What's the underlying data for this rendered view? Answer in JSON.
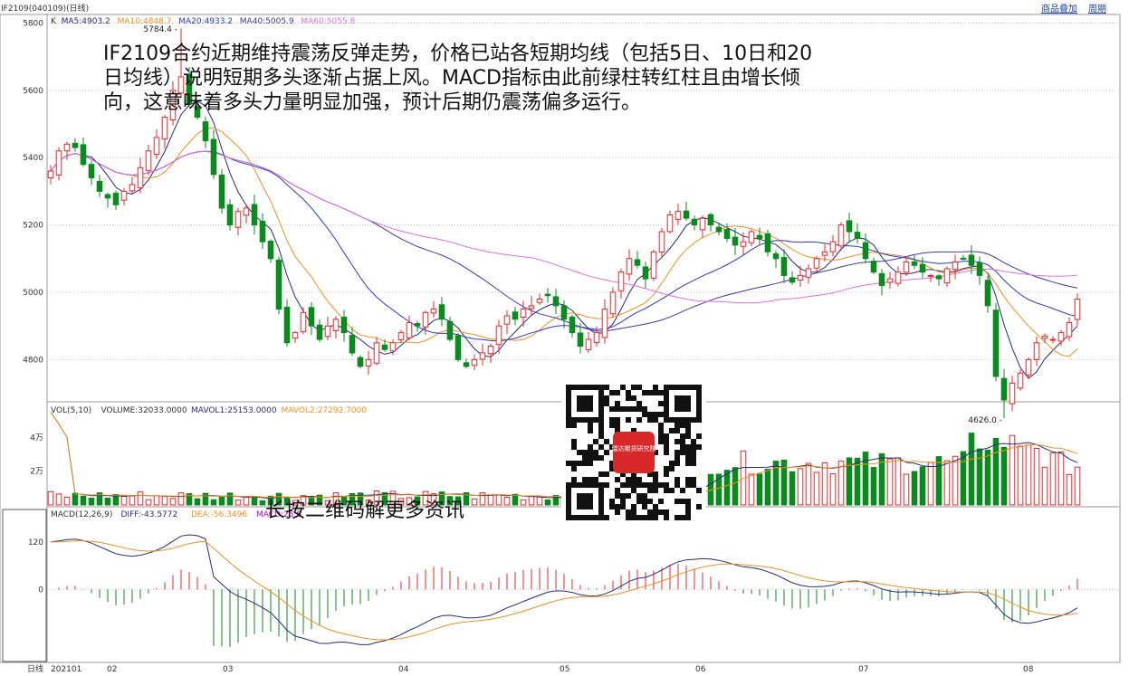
{
  "header": {
    "code": "IF2109(040109)(日线)",
    "link_overlay": "商品叠加",
    "link_period": "周期"
  },
  "overlay": {
    "commentary": "IF2109合约近期维持震荡反弹走势，价格已站各短期均线（包括5日、10日和20日均线）说明短期多头逐渐占据上风。MACD指标由此前绿柱转红柱且由增长倾向，这意味着多头力量明显加强，预计后期仍震荡偏多运行。",
    "qr_caption": "长按二维码解更多资讯",
    "qr_logo": "瑞达期货研究院"
  },
  "colors": {
    "up": "#e8262a",
    "down": "#0b8a1e",
    "ma5": "#2a2a7a",
    "ma10": "#f0901e",
    "ma20": "#2a3ad0",
    "ma40": "#3a3ab0",
    "ma60": "#e070e0",
    "grid": "#c8c8c8"
  },
  "chart_data": [
    {
      "type": "candlestick",
      "legend": [
        {
          "name": "K",
          "value": "",
          "color": "#333333"
        },
        {
          "name": "MA5",
          "value": "4903.2",
          "color": "#2a2a7a"
        },
        {
          "name": "MA10",
          "value": "4848.7",
          "color": "#f0901e"
        },
        {
          "name": "MA20",
          "value": "4933.2",
          "color": "#2a3ad0"
        },
        {
          "name": "MA40",
          "value": "5005.9",
          "color": "#3a3ab0"
        },
        {
          "name": "MA60",
          "value": "5055.8",
          "color": "#e070e0"
        }
      ],
      "ylim": [
        4680,
        5820
      ],
      "yticks": [
        4800,
        5000,
        5200,
        5400,
        5600,
        5800
      ],
      "x_labels": [
        "202101",
        "02",
        "03",
        "04",
        "05",
        "06",
        "07",
        "08"
      ],
      "annotations": [
        {
          "text": "5784.4",
          "kind": "high"
        },
        {
          "text": "4626.0",
          "kind": "low"
        }
      ],
      "closes": [
        5360,
        5420,
        5440,
        5430,
        5380,
        5340,
        5300,
        5280,
        5260,
        5300,
        5320,
        5370,
        5420,
        5460,
        5520,
        5600,
        5640,
        5560,
        5520,
        5450,
        5350,
        5250,
        5200,
        5240,
        5250,
        5200,
        5150,
        5100,
        4950,
        4850,
        4880,
        4940,
        4900,
        4860,
        4900,
        4920,
        4880,
        4820,
        4780,
        4800,
        4850,
        4830,
        4850,
        4880,
        4910,
        4900,
        4940,
        4950,
        4920,
        4860,
        4800,
        4780,
        4800,
        4820,
        4840,
        4900,
        4930,
        4920,
        4950,
        4960,
        4980,
        4990,
        4960,
        4920,
        4880,
        4840,
        4860,
        4880,
        4950,
        5000,
        5060,
        5100,
        5080,
        5040,
        5120,
        5180,
        5230,
        5240,
        5220,
        5200,
        5220,
        5200,
        5180,
        5160,
        5140,
        5150,
        5180,
        5160,
        5120,
        5100,
        5050,
        5030,
        5050,
        5070,
        5100,
        5120,
        5150,
        5200,
        5180,
        5160,
        5100,
        5060,
        5020,
        5040,
        5060,
        5090,
        5080,
        5060,
        5050,
        5040,
        5070,
        5090,
        5100,
        5080,
        5050,
        4960,
        4750,
        4680,
        4730,
        4760,
        4800,
        4850,
        4870,
        4860,
        4880,
        4910,
        4980
      ],
      "ma5_now": 4903.2,
      "ma10_now": 4848.7,
      "ma20_now": 4933.2,
      "ma40_now": 5005.9,
      "ma60_now": 5055.8
    },
    {
      "type": "bar",
      "legend": [
        {
          "name": "VOL(5,10)",
          "value": "",
          "color": "#333333"
        },
        {
          "name": "VOLUME",
          "value": "32033.0000",
          "color": "#333333"
        },
        {
          "name": "MAVOL1",
          "value": "25153.0000",
          "color": "#2a2a7a"
        },
        {
          "name": "MAVOL2",
          "value": "27292.7000",
          "color": "#f0901e"
        }
      ],
      "yticks": [
        "2万",
        "4万"
      ],
      "ylim": [
        0,
        60000
      ]
    },
    {
      "type": "bar",
      "legend": [
        {
          "name": "MACD(12,26,9)",
          "value": "",
          "color": "#333333"
        },
        {
          "name": "DIFF",
          "value": "-43.5772",
          "color": "#2a2a7a"
        },
        {
          "name": "DEA",
          "value": "-56.3496",
          "color": "#f0901e"
        },
        {
          "name": "MACD",
          "value": "25.5",
          "color": "#c000c0"
        }
      ],
      "yticks": [
        0,
        120
      ],
      "ylim": [
        -180,
        200
      ]
    }
  ],
  "footer": {
    "period_label": "日线"
  }
}
